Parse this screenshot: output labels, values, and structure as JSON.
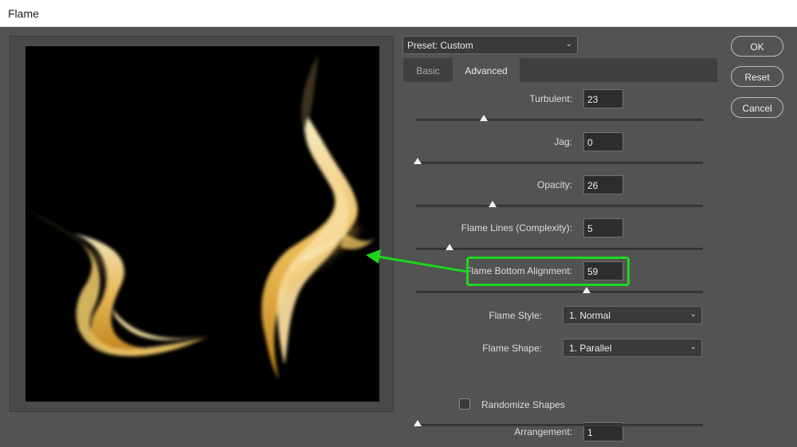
{
  "window": {
    "title": "Flame"
  },
  "preset": {
    "label": "Preset: Custom"
  },
  "tabs": [
    {
      "label": "Basic",
      "active": false
    },
    {
      "label": "Advanced",
      "active": true
    }
  ],
  "params": {
    "turbulent": {
      "label": "Turbulent:",
      "value": "23",
      "slider_fraction": 0.23
    },
    "jag": {
      "label": "Jag:",
      "value": "0",
      "slider_fraction": 0.0
    },
    "opacity": {
      "label": "Opacity:",
      "value": "26",
      "slider_fraction": 0.26
    },
    "flame_lines": {
      "label": "Flame Lines (Complexity):",
      "value": "5",
      "slider_fraction": 0.11
    },
    "flame_bottom_alignment": {
      "label": "Flame Bottom Alignment:",
      "value": "59",
      "slider_fraction": 0.59
    },
    "flame_style": {
      "label": "Flame Style:",
      "value": "1. Normal"
    },
    "flame_shape": {
      "label": "Flame Shape:",
      "value": "1. Parallel"
    },
    "randomize_shapes": {
      "label": "Randomize Shapes",
      "checked": false
    },
    "arrangement": {
      "label": "Arrangement:",
      "value": "1",
      "slider_fraction": 0.0
    }
  },
  "buttons": {
    "ok": "OK",
    "reset": "Reset",
    "cancel": "Cancel"
  },
  "annotation": {
    "highlight_color": "#1ed51e"
  },
  "icons": {
    "dropdown": "chevron-down-icon",
    "arrow": "arrow-left-icon"
  }
}
